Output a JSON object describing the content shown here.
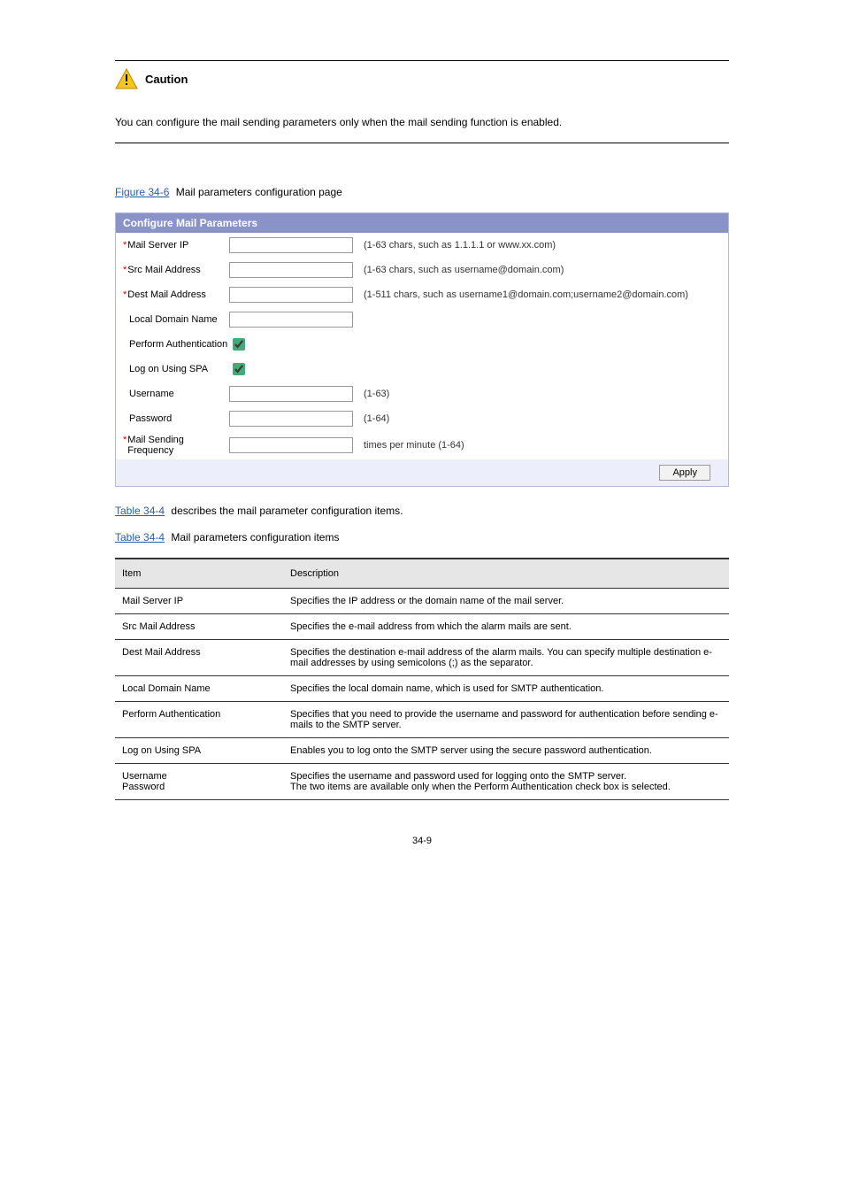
{
  "page_number": "34-9",
  "caution": {
    "label": "Caution",
    "text": "You can configure the mail sending parameters only when the mail sending function is enabled."
  },
  "figure4": {
    "caption_code": "Figure 34-6",
    "caption_text": "Mail parameters configuration page"
  },
  "panel": {
    "title": "Configure Mail Parameters",
    "rows": {
      "mail_server_ip": {
        "label": "Mail Server IP",
        "hint": "(1-63 chars, such as 1.1.1.1 or www.xx.com)",
        "value": ""
      },
      "src_mail": {
        "label": "Src Mail Address",
        "hint": "(1-63 chars, such as username@domain.com)",
        "value": ""
      },
      "dest_mail": {
        "label": "Dest Mail Address",
        "hint": "(1-511 chars, such as username1@domain.com;username2@domain.com)",
        "value": ""
      },
      "local_domain": {
        "label": "Local Domain Name",
        "value": ""
      },
      "perform_auth": {
        "label": "Perform Authentication",
        "checked": true
      },
      "spa": {
        "label": "Log on Using SPA",
        "checked": true
      },
      "username": {
        "label": "Username",
        "hint": "(1-63)",
        "value": ""
      },
      "password": {
        "label": "Password",
        "hint": "(1-64)",
        "value": ""
      },
      "freq": {
        "label": "Mail Sending Frequency",
        "hint": "times per minute (1-64)",
        "value": ""
      }
    },
    "apply_label": "Apply"
  },
  "table": {
    "caption_code": "Table 34-4",
    "caption_text": "describes the mail parameter configuration items.",
    "caption_title": "Mail parameters configuration items",
    "header": {
      "item": "Item",
      "desc": "Description"
    },
    "rows": [
      {
        "item": "Mail Server IP",
        "desc": "Specifies the IP address or the domain name of the mail server."
      },
      {
        "item": "Src Mail Address",
        "desc": "Specifies the e-mail address from which the alarm mails are sent."
      },
      {
        "item": "Dest Mail Address",
        "desc": "Specifies the destination e-mail address of the alarm mails. You can specify multiple destination e-mail addresses by using semicolons (;) as the separator."
      },
      {
        "item": "Local Domain Name",
        "desc": "Specifies the local domain name, which is used for SMTP authentication."
      },
      {
        "item": "Perform Authentication",
        "desc": "Specifies that you need to provide the username and password for authentication before sending e-mails to the SMTP server."
      },
      {
        "item": "Log on Using SPA",
        "desc": "Enables you to log onto the SMTP server using the secure password authentication."
      },
      {
        "item": "Username\nPassword",
        "desc": "Specifies the username and password used for logging onto the SMTP server.\nThe two items are available only when the Perform Authentication check box is selected."
      }
    ]
  }
}
